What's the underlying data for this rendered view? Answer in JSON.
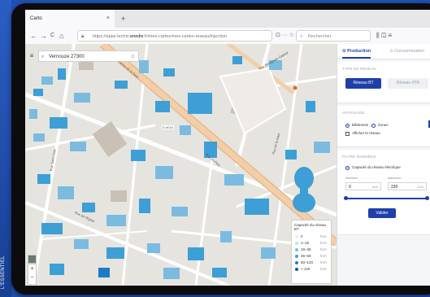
{
  "caption": "L'ESSENTIEL",
  "browser": {
    "tab_title": "Carto",
    "tab_close": "×",
    "new_tab": "+",
    "back": "←",
    "forward": "→",
    "reload": "C",
    "home": "⌂",
    "url_prefix": "https://apps-lectrix.",
    "url_host": "enedis",
    "url_path": ".fr/mes-cartes/mes-cartes-reseau/injection",
    "url_actions": "⊡ ··· ☆",
    "search_placeholder": "Rechercher",
    "menu_icons": "⫼ ◫ ≡"
  },
  "map": {
    "search_value": "Vernouze 27300",
    "search_clear": "⊙",
    "menu_glyph": "≡",
    "zoom_in": "+",
    "zoom_out": "−",
    "streets": {
      "main": "Avenue de la Gare",
      "avenue": "Rue du Pont",
      "top": "Rue Bonaparte Gabriel",
      "right": "Rue de la Gare",
      "left": "Rue Saint-Marc",
      "diag": "Rue de l'Église",
      "road_number": "D 6015"
    },
    "legend": {
      "title": "Capacité du réseau BT",
      "unit": "kVA",
      "items": [
        {
          "label": "0",
          "color": "#e8eef5"
        },
        {
          "label": "1–18",
          "color": "#c8def0"
        },
        {
          "label": "18–36",
          "color": "#7bbbe0"
        },
        {
          "label": "36–60",
          "color": "#3d9fd6"
        },
        {
          "label": "60–120",
          "color": "#1b7cc4"
        },
        {
          "label": "> 120",
          "color": "#0e5aa3"
        }
      ]
    }
  },
  "panel": {
    "tab_production": "Production",
    "tab_consumption": "Consommation",
    "type_title": "TYPE DE RÉSEAU",
    "btn_bt": "Réseau BT",
    "btn_hta": "Réseau HTA",
    "display_title": "AFFICHAGE",
    "radio_batiments": "Bâtiments",
    "radio_zones": "Zones",
    "checkbox_reseau": "Afficher le réseau",
    "filters_title": "FILTRE DONNÉES",
    "filter_capacity": "Capacité du réseau électrique",
    "min_label": "Minimum",
    "max_label": "Maximum",
    "min_value": "0",
    "max_value": "230",
    "unit": "kVA",
    "min_fraction": 0.0,
    "max_fraction": 1.0,
    "apply_button": "Valider"
  }
}
